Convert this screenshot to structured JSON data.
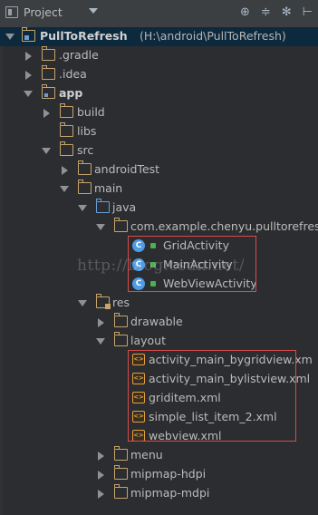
{
  "toolbar": {
    "title": "Project",
    "icons": [
      "project-icon",
      "dropdown-icon",
      "sync-icon",
      "collapse-icon",
      "settings-icon",
      "hide-icon"
    ]
  },
  "tree": {
    "root": {
      "name": "PullToRefresh",
      "path": "(H:\\android\\PullToRefresh)"
    },
    "items": [
      {
        "label": ".gradle"
      },
      {
        "label": ".idea"
      },
      {
        "label": "app"
      },
      {
        "label": "build"
      },
      {
        "label": "libs"
      },
      {
        "label": "src"
      },
      {
        "label": "androidTest"
      },
      {
        "label": "main"
      },
      {
        "label": "java"
      },
      {
        "label": "com.example.chenyu.pulltorefres"
      },
      {
        "label": "GridActivity"
      },
      {
        "label": "MainActivity"
      },
      {
        "label": "WebViewActivity"
      },
      {
        "label": "res"
      },
      {
        "label": "drawable"
      },
      {
        "label": "layout"
      },
      {
        "label": "activity_main_bygridview.xm"
      },
      {
        "label": "activity_main_bylistview.xml"
      },
      {
        "label": "griditem.xml"
      },
      {
        "label": "simple_list_item_2.xml"
      },
      {
        "label": "webview.xml"
      },
      {
        "label": "menu"
      },
      {
        "label": "mipmap-hdpi"
      },
      {
        "label": "mipmap-mdpi"
      }
    ]
  },
  "watermark": "http://blog.csdn.net/",
  "colors": {
    "highlight_box": "#d84b4b",
    "selected_row": "#0d293e",
    "folder": "#c8a36b",
    "class_icon": "#4d9ce6"
  }
}
